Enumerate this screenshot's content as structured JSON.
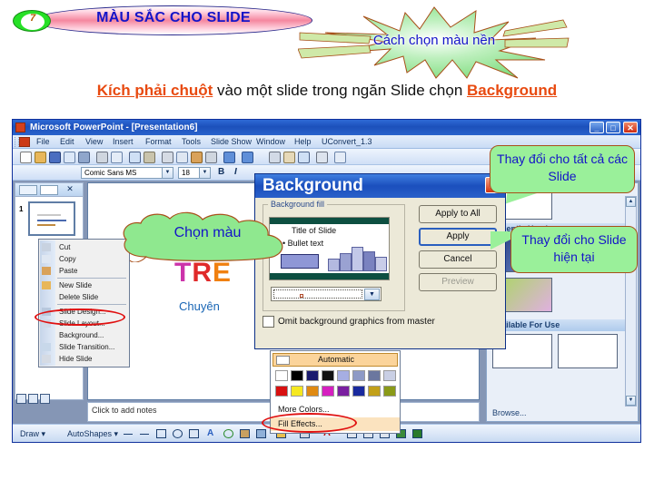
{
  "slide": {
    "badge_number": "7",
    "title": "MÀU SẮC CHO SLIDE",
    "starburst_text": "Cách chọn màu nền",
    "instruction": {
      "part1": "Kích phải chuột",
      "part2": " vào một slide trong ngăn Slide chọn ",
      "part3": "Background"
    },
    "colors": {
      "title_text": "#1414c8",
      "title_fill": "#f5879f",
      "badge_fill": "#26e026",
      "starburst_fill": "#9af09a",
      "highlight_text": "#e84a10",
      "callout_fill": "#9af09a",
      "callout_border": "#a8501a",
      "marker_ellipse": "#e01010"
    }
  },
  "callouts": {
    "choose_color": "Chọn màu",
    "apply_all": "Thay đổi cho tất cả các Slide",
    "apply_current": "Thay đổi cho Slide hiện tại"
  },
  "powerpoint": {
    "titlebar": {
      "title": "Microsoft PowerPoint - [Presentation6]",
      "minimize": "_",
      "maximize": "□",
      "close": "✕"
    },
    "menus": [
      "File",
      "Edit",
      "View",
      "Insert",
      "Format",
      "Tools",
      "Slide Show",
      "Window",
      "Help",
      "UConvert_1.3"
    ],
    "formatting": {
      "font_name": "Comic Sans MS",
      "font_size": "18",
      "bold": "B",
      "italic": "I"
    },
    "outline_pane": {
      "slide_number": "1"
    },
    "slide": {
      "word": "TRE",
      "subword": "Chuyên"
    },
    "notes_placeholder": "Click to add notes",
    "task_pane": {
      "recently_used": "Recently Used",
      "available_for_use": "Available For Use",
      "browse": "Browse..."
    },
    "drawing_toolbar": {
      "draw": "Draw ▾",
      "autoshapes": "AutoShapes ▾"
    }
  },
  "context_menu": {
    "items": [
      {
        "label": "Cut",
        "icon": "scissors-icon"
      },
      {
        "label": "Copy",
        "icon": "copy-icon"
      },
      {
        "label": "Paste",
        "icon": "paste-icon"
      },
      {
        "label": "New Slide",
        "icon": "new-slide-icon"
      },
      {
        "label": "Delete Slide",
        "icon": "delete-slide-icon"
      },
      {
        "label": "Slide Design...",
        "icon": "slide-design-icon"
      },
      {
        "label": "Slide Layout...",
        "icon": "slide-layout-icon"
      },
      {
        "label": "Background...",
        "icon": "background-icon"
      },
      {
        "label": "Slide Transition...",
        "icon": "transition-icon"
      },
      {
        "label": "Hide Slide",
        "icon": "hide-slide-icon"
      }
    ]
  },
  "background_dialog": {
    "title": "Background",
    "close_glyph": "✕",
    "group_label": "Background fill",
    "preview": {
      "title": "Title of Slide",
      "bullet": "•  Bullet text"
    },
    "omit_label": "Omit background graphics from master",
    "buttons": {
      "apply_to_all": "Apply to All",
      "apply": "Apply",
      "cancel": "Cancel",
      "preview": "Preview"
    }
  },
  "color_menu": {
    "automatic": "Automatic",
    "row1": [
      "#ffffff",
      "#000000",
      "#1b1b6e",
      "#111111",
      "#a6aee2",
      "#8e9ac6",
      "#6b779f",
      "#c9cfe4"
    ],
    "row2": [
      "#d81010",
      "#f5e820",
      "#e08a12",
      "#d61fc0",
      "#7a1fa0",
      "#1a2a9e",
      "#c2a018",
      "#8a9a18"
    ],
    "more_colors": "More Colors...",
    "fill_effects": "Fill Effects..."
  }
}
